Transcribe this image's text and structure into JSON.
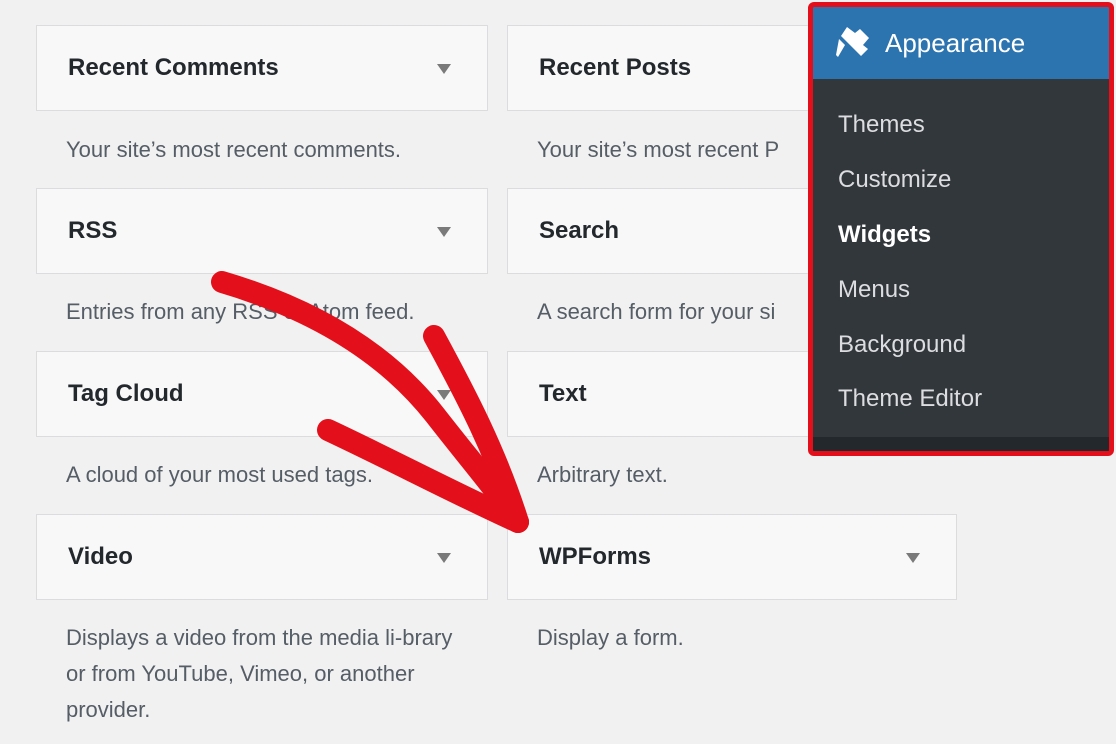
{
  "widgets": [
    {
      "title": "Recent Comments",
      "desc": "Your site’s most recent comments."
    },
    {
      "title": "Recent Posts",
      "desc": "Your site’s most recent P"
    },
    {
      "title": "RSS",
      "desc": "Entries from any RSS or Atom feed."
    },
    {
      "title": "Search",
      "desc": "A search form for your si"
    },
    {
      "title": "Tag Cloud",
      "desc": "A cloud of your most used tags."
    },
    {
      "title": "Text",
      "desc": "Arbitrary text."
    },
    {
      "title": "Video",
      "desc": "Displays a video from the media li-brary or from YouTube, Vimeo, or another provider."
    },
    {
      "title": "WPForms",
      "desc": "Display a form."
    }
  ],
  "appearance_menu": {
    "title": "Appearance",
    "icon": "paintbrush-icon",
    "items": [
      "Themes",
      "Customize",
      "Widgets",
      "Menus",
      "Background",
      "Theme Editor"
    ],
    "current": "Widgets",
    "header_color": "#2c74b0",
    "bg_color": "#32373c",
    "highlight_border": "#e3101b"
  },
  "annotation": {
    "icon": "red-arrow-icon",
    "color": "#e3101b"
  }
}
